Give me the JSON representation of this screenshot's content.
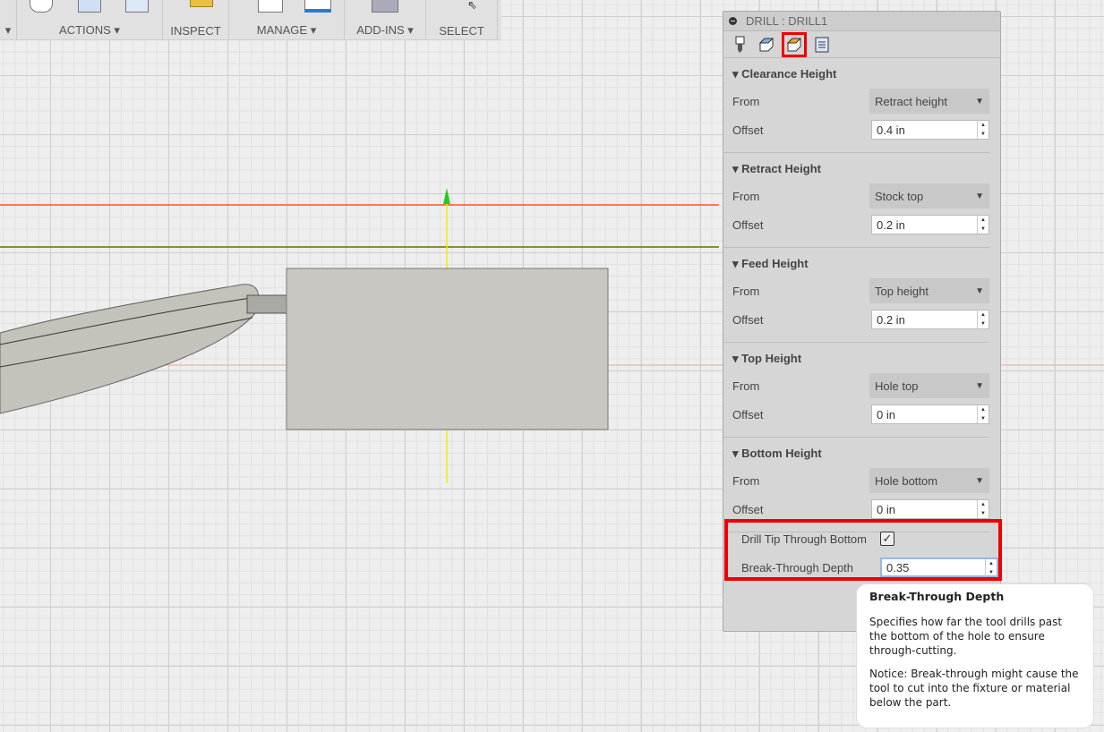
{
  "toolbar": {
    "groups": [
      {
        "label": "ACTIONS ▾"
      },
      {
        "label": "INSPECT"
      },
      {
        "label": "MANAGE ▾"
      },
      {
        "label": "ADD-INS ▾"
      },
      {
        "label": "SELECT"
      }
    ],
    "leading_arrow": "▾"
  },
  "panel": {
    "title": "DRILL : DRILL1",
    "tabs": [
      "tool-tab",
      "geometry-tab",
      "heights-tab",
      "passes-tab"
    ],
    "sections": [
      {
        "title": "Clearance Height",
        "from_label": "From",
        "from_value": "Retract height",
        "offset_label": "Offset",
        "offset_value": "0.4 in"
      },
      {
        "title": "Retract Height",
        "from_label": "From",
        "from_value": "Stock top",
        "offset_label": "Offset",
        "offset_value": "0.2 in"
      },
      {
        "title": "Feed Height",
        "from_label": "From",
        "from_value": "Top height",
        "offset_label": "Offset",
        "offset_value": "0.2 in"
      },
      {
        "title": "Top Height",
        "from_label": "From",
        "from_value": "Hole top",
        "offset_label": "Offset",
        "offset_value": "0 in"
      },
      {
        "title": "Bottom Height",
        "from_label": "From",
        "from_value": "Hole bottom",
        "offset_label": "Offset",
        "offset_value": "0 in"
      }
    ],
    "drill_tip_label": "Drill Tip Through Bottom",
    "drill_tip_checked": true,
    "checkmark": "✓",
    "break_label": "Break-Through Depth",
    "break_value": "0.35"
  },
  "tooltip": {
    "title": "Break-Through Depth",
    "p1": "Specifies how far the tool drills past the bottom of the hole to ensure through-cutting.",
    "p2": "Notice: Break-through might cause the tool to cut into the fixture or material below the part."
  },
  "colors": {
    "highlight": "#ee0000",
    "clearance_line": "#ff5522",
    "retract_line": "#6b6b00",
    "axis": "#ffff00"
  }
}
